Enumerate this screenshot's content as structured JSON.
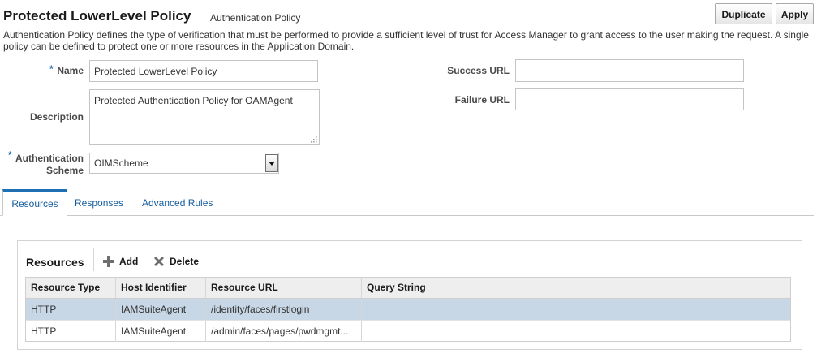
{
  "header": {
    "title": "Protected LowerLevel Policy",
    "subtitle": "Authentication Policy",
    "duplicate_label": "Duplicate",
    "apply_label": "Apply"
  },
  "description_text": "Authentication Policy defines the type of verification that must be performed to provide a sufficient level of trust for Access Manager to grant access to the user making the request. A single policy can be defined to protect one or more resources in the Application Domain.",
  "form": {
    "required_mark": "*",
    "name_label": "Name",
    "name_value": "Protected LowerLevel Policy",
    "description_label": "Description",
    "description_value": "Protected Authentication Policy for OAMAgent",
    "scheme_label_line1": "Authentication",
    "scheme_label_line2": "Scheme",
    "scheme_value": "OIMScheme",
    "success_url_label": "Success URL",
    "success_url_value": "",
    "failure_url_label": "Failure URL",
    "failure_url_value": ""
  },
  "tabs": [
    {
      "label": "Resources",
      "active": true
    },
    {
      "label": "Responses",
      "active": false
    },
    {
      "label": "Advanced Rules",
      "active": false
    }
  ],
  "resources": {
    "title": "Resources",
    "add_label": "Add",
    "delete_label": "Delete",
    "add_icon": "plus-icon",
    "delete_icon": "x-icon",
    "columns": [
      "Resource Type",
      "Host Identifier",
      "Resource URL",
      "Query String"
    ],
    "rows": [
      {
        "type": "HTTP",
        "host": "IAMSuiteAgent",
        "url": "/identity/faces/firstlogin",
        "query": "",
        "selected": true
      },
      {
        "type": "HTTP",
        "host": "IAMSuiteAgent",
        "url": "/admin/faces/pages/pwdmgmt...",
        "query": "",
        "selected": false
      }
    ]
  },
  "colors": {
    "accent": "#1f6fb5",
    "link": "#145c9e",
    "selected_row": "#c8d7e6",
    "header_row": "#eeeeee"
  }
}
